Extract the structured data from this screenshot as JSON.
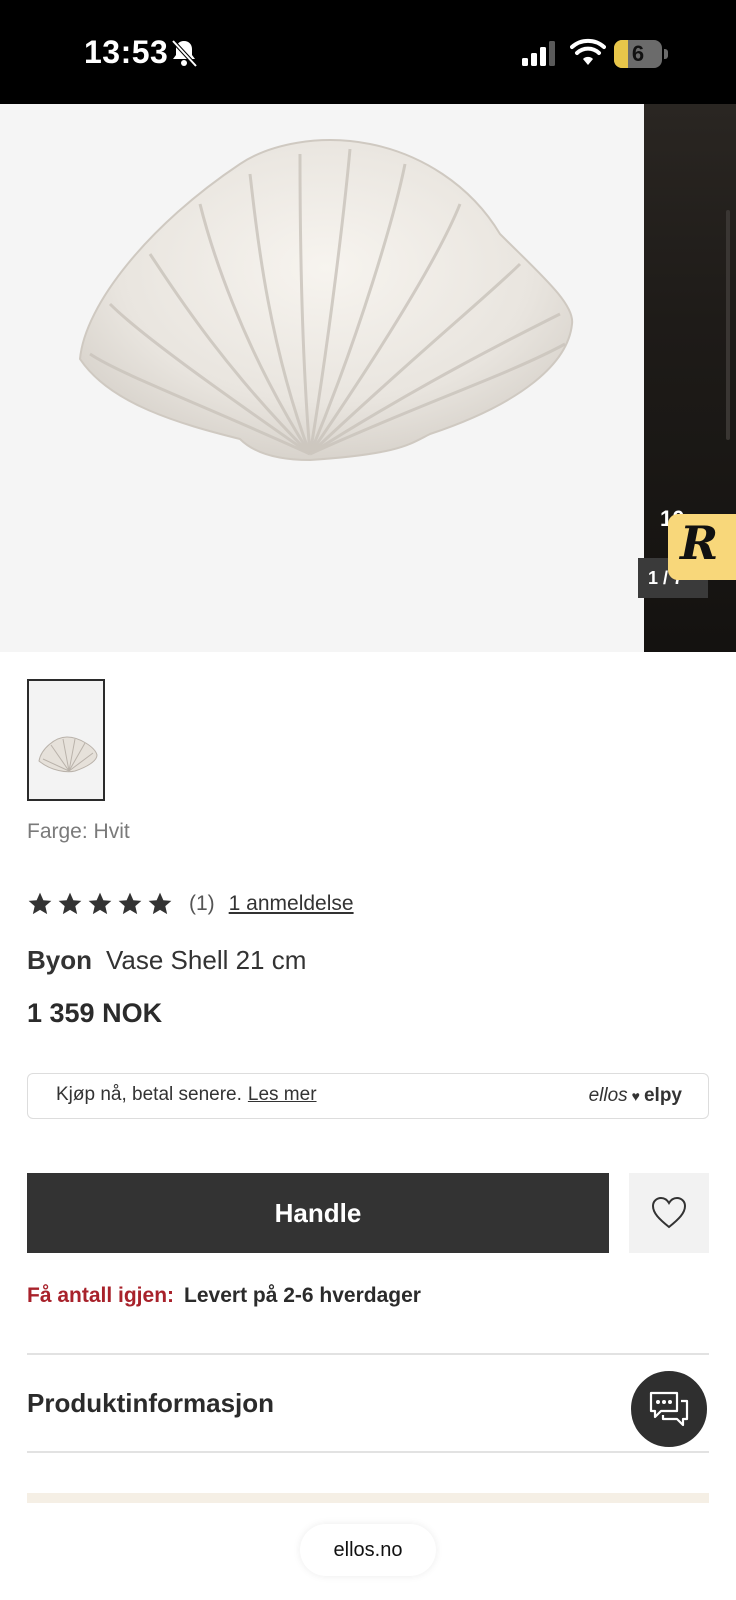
{
  "status_bar": {
    "time": "13:53",
    "battery_level": "6",
    "icons": [
      "bell-slash-icon",
      "cellular-signal-icon",
      "wifi-icon",
      "battery-icon"
    ]
  },
  "gallery": {
    "pager_text": "1 / 7",
    "promo_count": "10",
    "promo_letter": "R"
  },
  "product": {
    "color_label": "Farge: Hvit",
    "rating_stars": 5,
    "rating_count": "(1)",
    "reviews_link": "1 anmeldelse",
    "brand": "Byon",
    "name": "Vase Shell 21 cm",
    "price": "1 359 NOK"
  },
  "payment": {
    "text": "Kjøp nå, betal senere.",
    "link": "Les mer",
    "logo_ellos": "ellos",
    "logo_heart": "♥",
    "logo_elpy": "elpy"
  },
  "actions": {
    "buy_label": "Handle"
  },
  "delivery": {
    "warning": "Få antall igjen:",
    "info": "Levert på 2-6 hverdager"
  },
  "sections": {
    "product_info": "Produktinformasjon"
  },
  "browser": {
    "url": "ellos.no"
  },
  "colors": {
    "primary_button": "#333333",
    "warning_text": "#a8222b",
    "promo_badge": "#f8d77a"
  }
}
